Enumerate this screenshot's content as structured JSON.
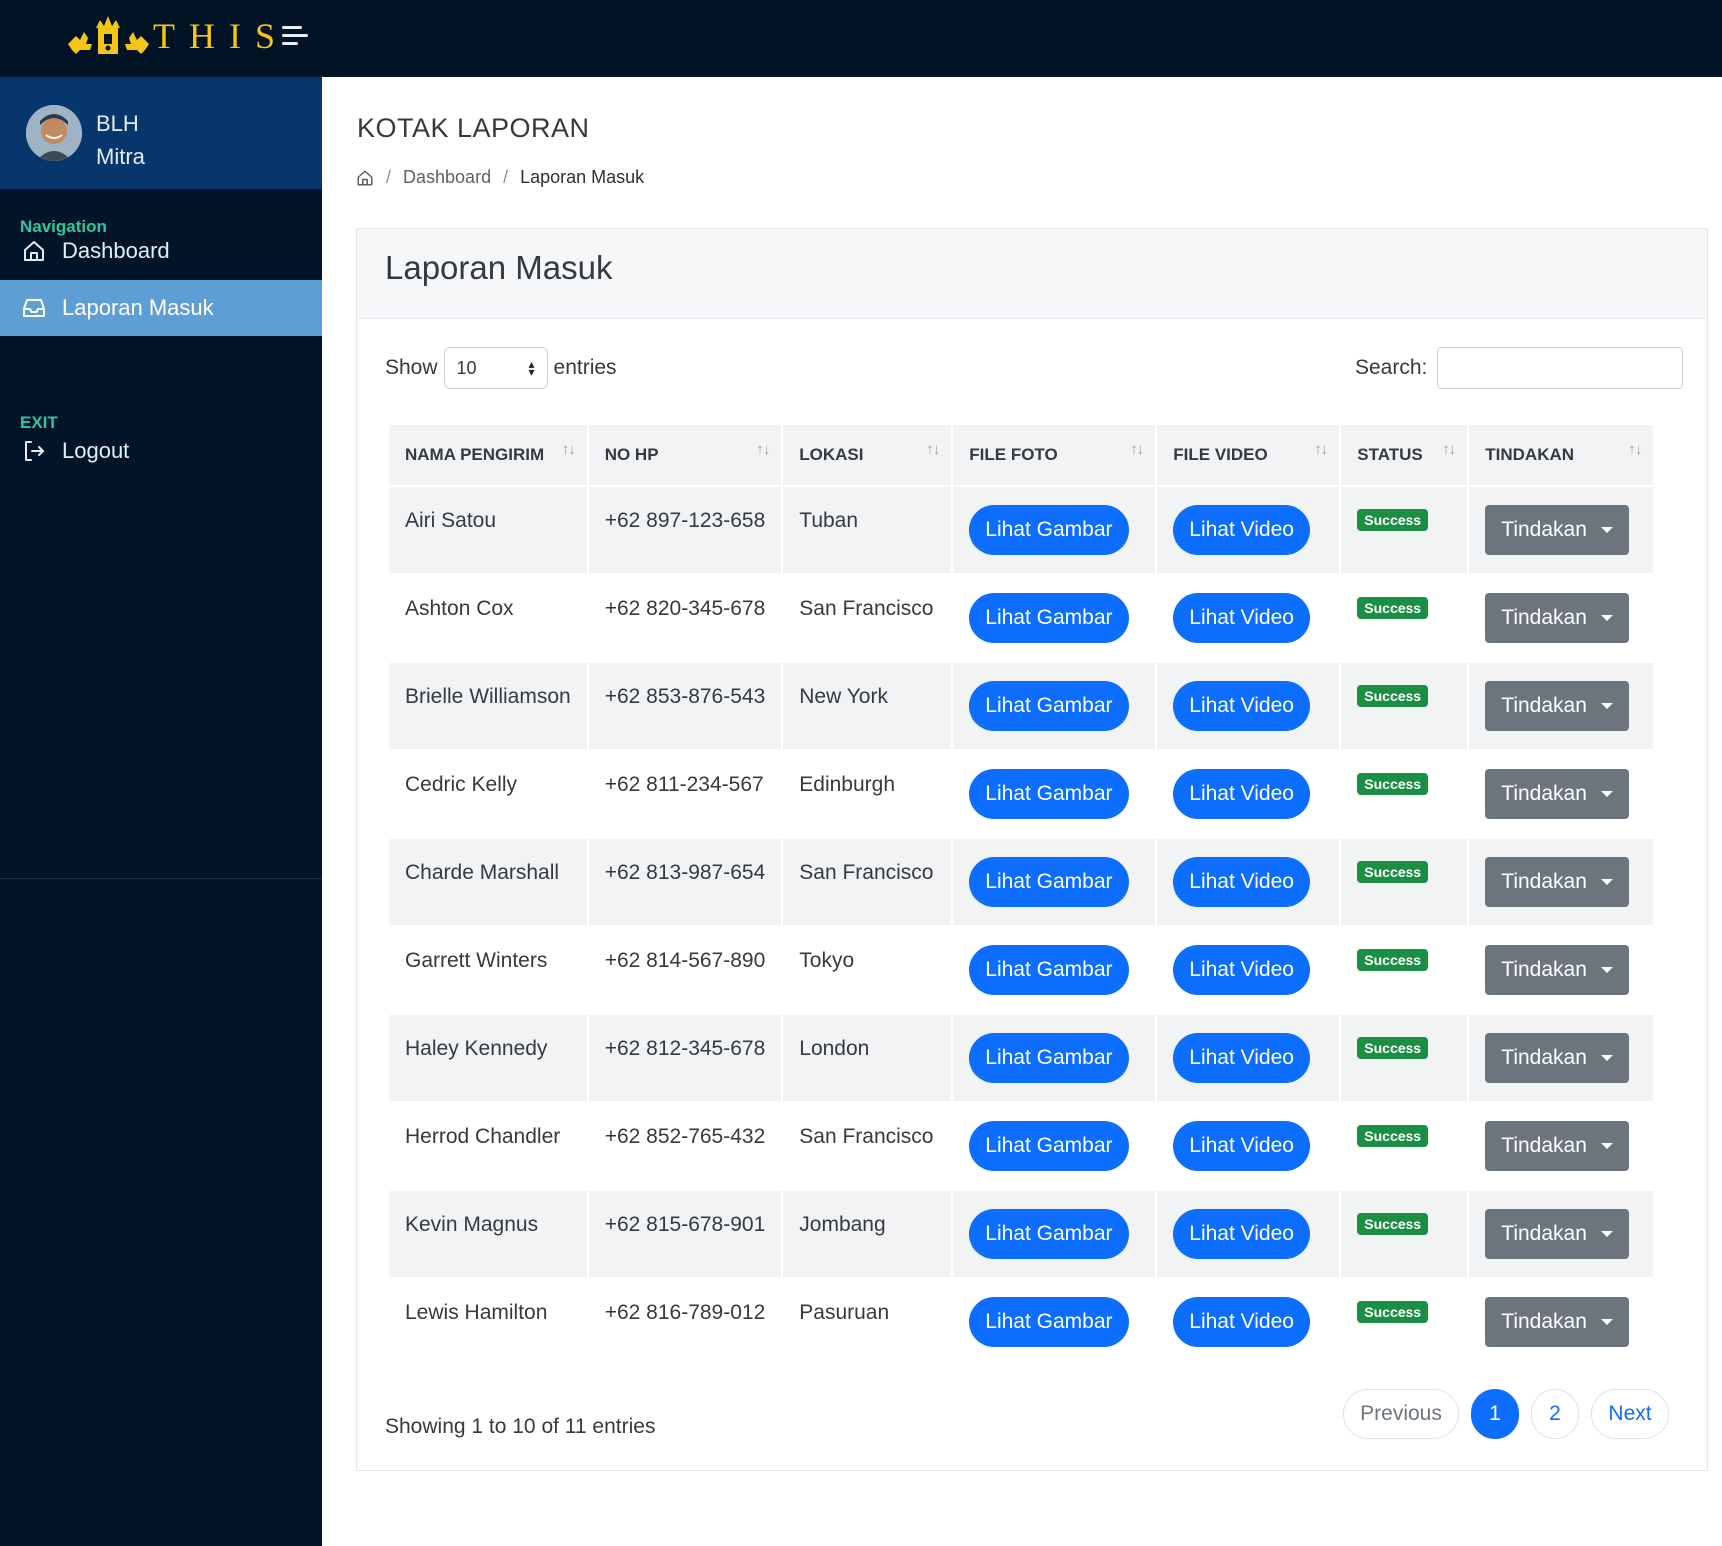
{
  "app": {
    "logo_text": "THIS"
  },
  "sidebar": {
    "user": {
      "line1": "BLH",
      "line2": "Mitra"
    },
    "section_navigation": "Navigation",
    "items": [
      {
        "label": "Dashboard",
        "icon": "home-icon"
      },
      {
        "label": "Laporan Masuk",
        "icon": "inbox-icon",
        "active": true
      }
    ],
    "section_exit": "EXIT",
    "logout_label": "Logout"
  },
  "header": {
    "page_title": "KOTAK LAPORAN",
    "breadcrumb": [
      "Dashboard",
      "Laporan Masuk"
    ]
  },
  "card": {
    "title": "Laporan Masuk"
  },
  "controls": {
    "show_label": "Show",
    "entries_value": "10",
    "entries_label": "entries",
    "search_label": "Search:",
    "search_value": ""
  },
  "table": {
    "columns": [
      "NAMA PENGIRIM",
      "NO HP",
      "LOKASI",
      "FILE FOTO",
      "FILE VIDEO",
      "STATUS",
      "TINDAKAN"
    ],
    "sort_icon": "sort-icon",
    "photo_button": "Lihat Gambar",
    "video_button": "Lihat Video",
    "action_button": "Tindakan",
    "rows": [
      {
        "name": "Airi Satou",
        "phone": "+62 897-123-658",
        "location": "Tuban",
        "status": "Success"
      },
      {
        "name": "Ashton Cox",
        "phone": "+62 820-345-678",
        "location": "San Francisco",
        "status": "Success"
      },
      {
        "name": "Brielle Williamson",
        "phone": "+62 853-876-543",
        "location": "New York",
        "status": "Success"
      },
      {
        "name": "Cedric Kelly",
        "phone": "+62 811-234-567",
        "location": "Edinburgh",
        "status": "Success"
      },
      {
        "name": "Charde Marshall",
        "phone": "+62 813-987-654",
        "location": "San Francisco",
        "status": "Success"
      },
      {
        "name": "Garrett Winters",
        "phone": "+62 814-567-890",
        "location": "Tokyo",
        "status": "Success"
      },
      {
        "name": "Haley Kennedy",
        "phone": "+62 812-345-678",
        "location": "London",
        "status": "Success"
      },
      {
        "name": "Herrod Chandler",
        "phone": "+62 852-765-432",
        "location": "San Francisco",
        "status": "Success"
      },
      {
        "name": "Kevin Magnus",
        "phone": "+62 815-678-901",
        "location": "Jombang",
        "status": "Success"
      },
      {
        "name": "Lewis Hamilton",
        "phone": "+62 816-789-012",
        "location": "Pasuruan",
        "status": "Success"
      }
    ]
  },
  "footer": {
    "info": "Showing 1 to 10 of 11 entries",
    "previous": "Previous",
    "pages": [
      "1",
      "2"
    ],
    "current_page": "1",
    "next": "Next"
  },
  "colors": {
    "topbar": "#011325",
    "sidebar": "#021528",
    "profile_bg": "#06366b",
    "active_nav": "#5d9fd4",
    "primary": "#0d6efd",
    "success": "#1a8f44",
    "secondary": "#6c757d",
    "logo_gold": "#f5c518"
  }
}
